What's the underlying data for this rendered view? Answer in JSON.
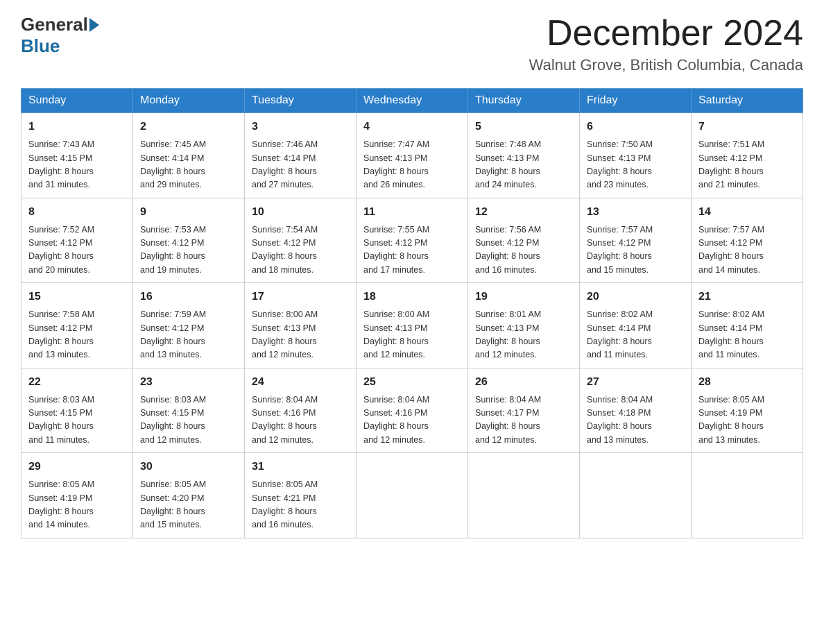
{
  "header": {
    "logo_general": "General",
    "logo_blue": "Blue",
    "month_title": "December 2024",
    "location": "Walnut Grove, British Columbia, Canada"
  },
  "days_of_week": [
    "Sunday",
    "Monday",
    "Tuesday",
    "Wednesday",
    "Thursday",
    "Friday",
    "Saturday"
  ],
  "weeks": [
    [
      {
        "day": "1",
        "sunrise": "7:43 AM",
        "sunset": "4:15 PM",
        "daylight": "8 hours and 31 minutes."
      },
      {
        "day": "2",
        "sunrise": "7:45 AM",
        "sunset": "4:14 PM",
        "daylight": "8 hours and 29 minutes."
      },
      {
        "day": "3",
        "sunrise": "7:46 AM",
        "sunset": "4:14 PM",
        "daylight": "8 hours and 27 minutes."
      },
      {
        "day": "4",
        "sunrise": "7:47 AM",
        "sunset": "4:13 PM",
        "daylight": "8 hours and 26 minutes."
      },
      {
        "day": "5",
        "sunrise": "7:48 AM",
        "sunset": "4:13 PM",
        "daylight": "8 hours and 24 minutes."
      },
      {
        "day": "6",
        "sunrise": "7:50 AM",
        "sunset": "4:13 PM",
        "daylight": "8 hours and 23 minutes."
      },
      {
        "day": "7",
        "sunrise": "7:51 AM",
        "sunset": "4:12 PM",
        "daylight": "8 hours and 21 minutes."
      }
    ],
    [
      {
        "day": "8",
        "sunrise": "7:52 AM",
        "sunset": "4:12 PM",
        "daylight": "8 hours and 20 minutes."
      },
      {
        "day": "9",
        "sunrise": "7:53 AM",
        "sunset": "4:12 PM",
        "daylight": "8 hours and 19 minutes."
      },
      {
        "day": "10",
        "sunrise": "7:54 AM",
        "sunset": "4:12 PM",
        "daylight": "8 hours and 18 minutes."
      },
      {
        "day": "11",
        "sunrise": "7:55 AM",
        "sunset": "4:12 PM",
        "daylight": "8 hours and 17 minutes."
      },
      {
        "day": "12",
        "sunrise": "7:56 AM",
        "sunset": "4:12 PM",
        "daylight": "8 hours and 16 minutes."
      },
      {
        "day": "13",
        "sunrise": "7:57 AM",
        "sunset": "4:12 PM",
        "daylight": "8 hours and 15 minutes."
      },
      {
        "day": "14",
        "sunrise": "7:57 AM",
        "sunset": "4:12 PM",
        "daylight": "8 hours and 14 minutes."
      }
    ],
    [
      {
        "day": "15",
        "sunrise": "7:58 AM",
        "sunset": "4:12 PM",
        "daylight": "8 hours and 13 minutes."
      },
      {
        "day": "16",
        "sunrise": "7:59 AM",
        "sunset": "4:12 PM",
        "daylight": "8 hours and 13 minutes."
      },
      {
        "day": "17",
        "sunrise": "8:00 AM",
        "sunset": "4:13 PM",
        "daylight": "8 hours and 12 minutes."
      },
      {
        "day": "18",
        "sunrise": "8:00 AM",
        "sunset": "4:13 PM",
        "daylight": "8 hours and 12 minutes."
      },
      {
        "day": "19",
        "sunrise": "8:01 AM",
        "sunset": "4:13 PM",
        "daylight": "8 hours and 12 minutes."
      },
      {
        "day": "20",
        "sunrise": "8:02 AM",
        "sunset": "4:14 PM",
        "daylight": "8 hours and 11 minutes."
      },
      {
        "day": "21",
        "sunrise": "8:02 AM",
        "sunset": "4:14 PM",
        "daylight": "8 hours and 11 minutes."
      }
    ],
    [
      {
        "day": "22",
        "sunrise": "8:03 AM",
        "sunset": "4:15 PM",
        "daylight": "8 hours and 11 minutes."
      },
      {
        "day": "23",
        "sunrise": "8:03 AM",
        "sunset": "4:15 PM",
        "daylight": "8 hours and 12 minutes."
      },
      {
        "day": "24",
        "sunrise": "8:04 AM",
        "sunset": "4:16 PM",
        "daylight": "8 hours and 12 minutes."
      },
      {
        "day": "25",
        "sunrise": "8:04 AM",
        "sunset": "4:16 PM",
        "daylight": "8 hours and 12 minutes."
      },
      {
        "day": "26",
        "sunrise": "8:04 AM",
        "sunset": "4:17 PM",
        "daylight": "8 hours and 12 minutes."
      },
      {
        "day": "27",
        "sunrise": "8:04 AM",
        "sunset": "4:18 PM",
        "daylight": "8 hours and 13 minutes."
      },
      {
        "day": "28",
        "sunrise": "8:05 AM",
        "sunset": "4:19 PM",
        "daylight": "8 hours and 13 minutes."
      }
    ],
    [
      {
        "day": "29",
        "sunrise": "8:05 AM",
        "sunset": "4:19 PM",
        "daylight": "8 hours and 14 minutes."
      },
      {
        "day": "30",
        "sunrise": "8:05 AM",
        "sunset": "4:20 PM",
        "daylight": "8 hours and 15 minutes."
      },
      {
        "day": "31",
        "sunrise": "8:05 AM",
        "sunset": "4:21 PM",
        "daylight": "8 hours and 16 minutes."
      },
      null,
      null,
      null,
      null
    ]
  ],
  "labels": {
    "sunrise": "Sunrise: ",
    "sunset": "Sunset: ",
    "daylight": "Daylight: "
  }
}
